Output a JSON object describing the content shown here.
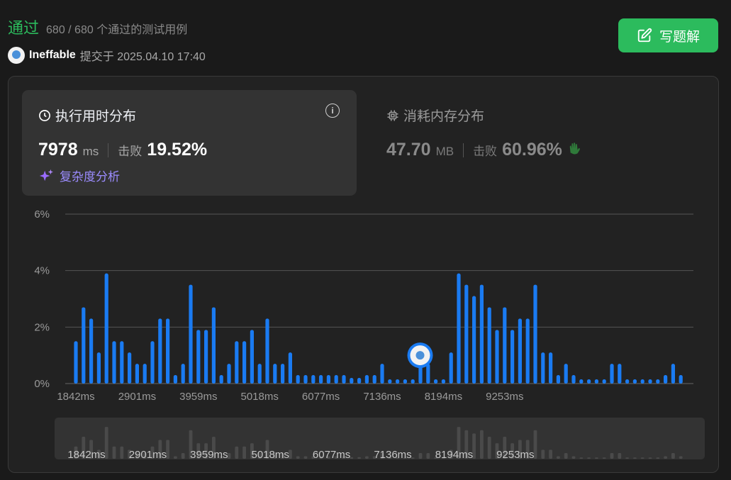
{
  "header": {
    "status": "通过",
    "testcases": "680 / 680 个通过的测试用例",
    "username": "Ineffable",
    "submitted_at": "提交于 2025.04.10 17:40",
    "write_solution": "写题解"
  },
  "runtime": {
    "title": "执行用时分布",
    "value": "7978",
    "unit": "ms",
    "beat_label": "击败",
    "beat_value": "19.52%",
    "complexity_link": "复杂度分析"
  },
  "memory": {
    "title": "消耗内存分布",
    "value": "47.70",
    "unit": "MB",
    "beat_label": "击败",
    "beat_value": "60.96%"
  },
  "colors": {
    "accent_green": "#2cbb5d",
    "bar_blue": "#1a7bf2",
    "grid": "#555555",
    "mini_bar": "#4a4a4a"
  },
  "chart_data": {
    "type": "bar",
    "ylabel": "",
    "xlabel": "",
    "yticks": [
      "0%",
      "2%",
      "4%",
      "6%"
    ],
    "ylim": [
      0,
      6
    ],
    "xtick_labels": [
      "1842ms",
      "2901ms",
      "3959ms",
      "5018ms",
      "6077ms",
      "7136ms",
      "8194ms",
      "9253ms"
    ],
    "xtick_positions": [
      0,
      8,
      16,
      24,
      32,
      40,
      48,
      56
    ],
    "user_bar_index": 45,
    "values": [
      1.5,
      2.7,
      2.3,
      1.1,
      3.9,
      1.5,
      1.5,
      1.1,
      0.7,
      0.7,
      1.5,
      2.3,
      2.3,
      0.3,
      0.7,
      3.5,
      1.9,
      1.9,
      2.7,
      0.3,
      0.7,
      1.5,
      1.5,
      1.9,
      0.7,
      2.3,
      0.7,
      0.7,
      1.1,
      0.3,
      0.3,
      0.3,
      0.3,
      0.3,
      0.3,
      0.3,
      0.2,
      0.2,
      0.3,
      0.3,
      0.7,
      0.15,
      0.15,
      0.15,
      0.15,
      0.7,
      0.7,
      0.15,
      0.15,
      1.1,
      3.9,
      3.5,
      3.1,
      3.5,
      2.7,
      1.9,
      2.7,
      1.9,
      2.3,
      2.3,
      3.5,
      1.1,
      1.1,
      0.3,
      0.7,
      0.3,
      0.15,
      0.15,
      0.15,
      0.15,
      0.7,
      0.7,
      0.15,
      0.15,
      0.15,
      0.15,
      0.15,
      0.3,
      0.7,
      0.3
    ]
  }
}
